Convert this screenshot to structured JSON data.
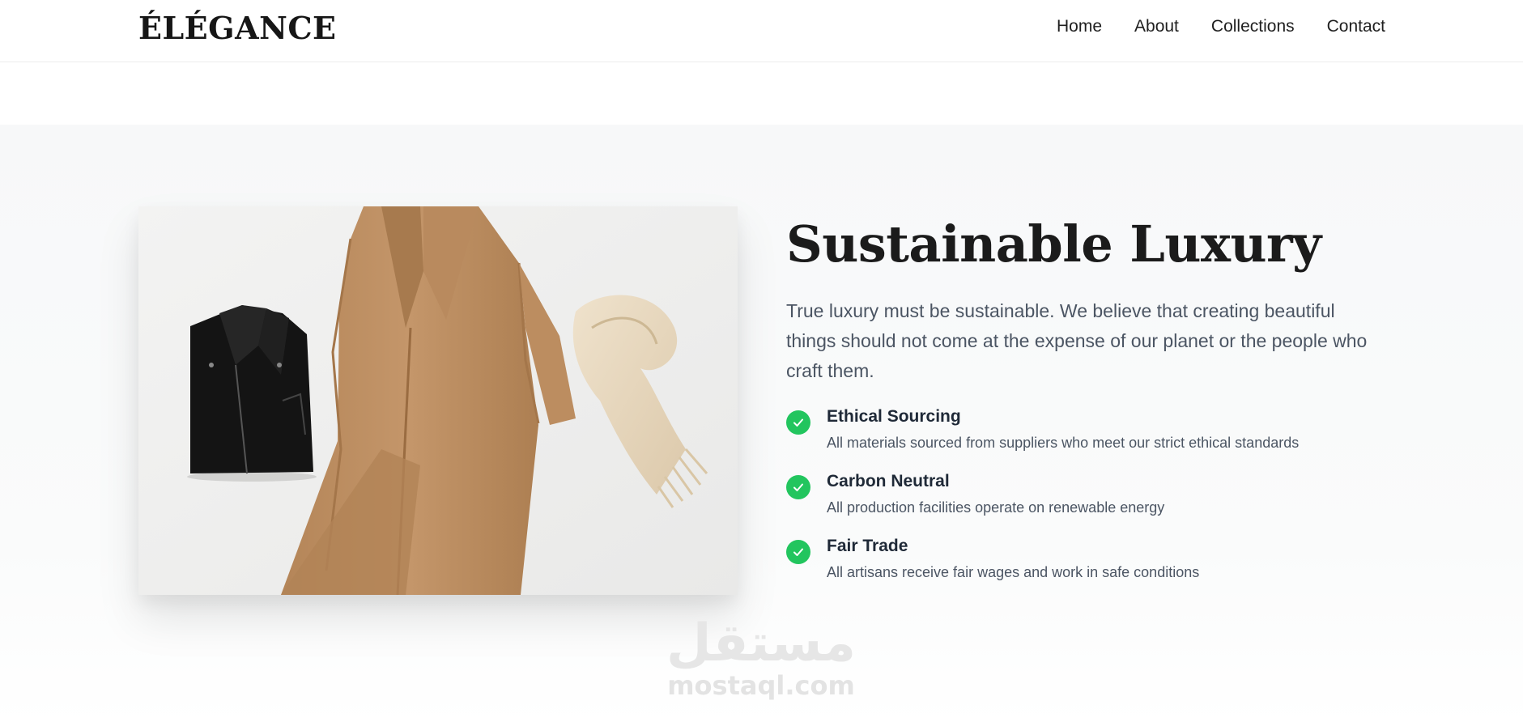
{
  "header": {
    "logo": "ÉLÉGANCE",
    "nav": [
      "Home",
      "About",
      "Collections",
      "Contact"
    ]
  },
  "section": {
    "title": "Sustainable Luxury",
    "intro": "True luxury must be sustainable. We believe that creating beautiful things should not come at the expense of our planet or the people who craft them.",
    "features": [
      {
        "title": "Ethical Sourcing",
        "description": "All materials sourced from suppliers who meet our strict ethical standards",
        "icon": "check-circle-icon"
      },
      {
        "title": "Carbon Neutral",
        "description": "All production facilities operate on renewable energy",
        "icon": "check-circle-icon"
      },
      {
        "title": "Fair Trade",
        "description": "All artisans receive fair wages and work in safe conditions",
        "icon": "check-circle-icon"
      }
    ],
    "image_subject": "leather jacket, camel coat and beige scarf flat lay"
  },
  "watermark": {
    "arabic": "مستقل",
    "latin": "mostaql.com"
  },
  "colors": {
    "accent": "#22c55e",
    "heading": "#1b1b1b",
    "body_text": "#4b5563",
    "section_bg": "#f7f8f9"
  }
}
